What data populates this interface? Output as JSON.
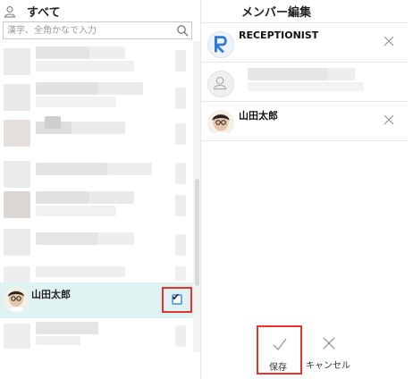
{
  "left_panel": {
    "header_label": "すべて",
    "search": {
      "placeholder": "漢字、全角かなで入力",
      "value": ""
    },
    "selected_user": {
      "name": "山田太郎",
      "checked": true
    }
  },
  "right_panel": {
    "title": "メンバー編集",
    "members": [
      {
        "name": "RECEPTIONIST"
      },
      {
        "name": ""
      },
      {
        "name": "山田太郎"
      }
    ]
  },
  "footer": {
    "save_label": "保存",
    "cancel_label": "キャンセル"
  },
  "colors": {
    "highlight": "#e8352b",
    "selected_row": "#e1f2f2",
    "checkbox_border": "#6aa6ea",
    "brand_blue": "#2c7bd9"
  }
}
